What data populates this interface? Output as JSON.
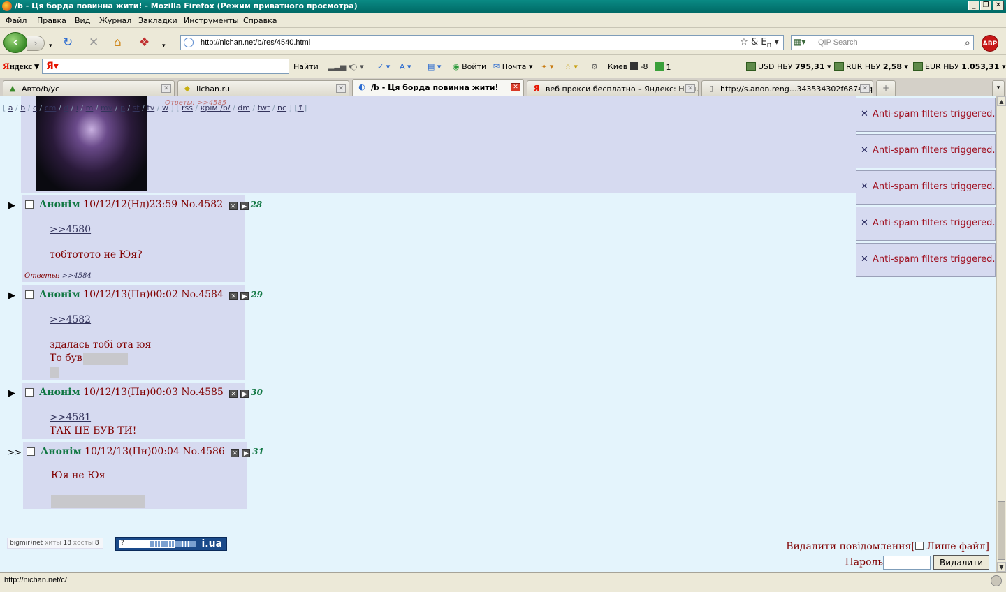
{
  "window": {
    "title": "/b - Ця борда повинна жити! - Mozilla Firefox (Режим приватного просмотра)"
  },
  "menu": [
    "Файл",
    "Правка",
    "Вид",
    "Журнал",
    "Закладки",
    "Инструменты",
    "Справка"
  ],
  "navbar": {
    "url": "http://nichan.net/b/res/4540.html",
    "search_placeholder": "QIP Search",
    "abp_label": "ABP"
  },
  "yandex_bar": {
    "logo_prefix": "Я",
    "logo_rest": "ндекс",
    "find": "Найти",
    "login": "Войти",
    "mail": "Почта",
    "city": "Киев",
    "temp": "-8",
    "count": "1",
    "usd_label": "USD НБУ",
    "usd_value": "795,31",
    "rur_label": "RUR НБУ",
    "rur_value": "2,58",
    "eur_label": "EUR НБУ",
    "eur_value": "1.053,31"
  },
  "tabs": [
    {
      "label": "Авто/b/ус",
      "active": false
    },
    {
      "label": "Ilchan.ru",
      "active": false
    },
    {
      "label": "/b - Ця борда повинна жити!",
      "active": true
    },
    {
      "label": "веб прокси бесплатно – Яндекс: Наш...",
      "active": false
    },
    {
      "label": "http://s.anon.reng...343534302f68746q6p",
      "active": false
    }
  ],
  "boardnav": {
    "links": [
      "a",
      "b",
      "c",
      "cm",
      "d",
      "i",
      "m",
      "mv",
      "p",
      "st",
      "tv",
      "w",
      "rss",
      "крім /b/",
      "dm",
      "twt",
      "nc",
      "↑"
    ],
    "overlay_replies": "Ответы: >>4585"
  },
  "posts": [
    {
      "name": "Анонім",
      "date": "10/12/12(Нд)23:59",
      "no": "No.4582",
      "num": "28",
      "marker": "▶",
      "reflink": ">>4580",
      "text": "тобтототo не Юя?",
      "replies_label": "Ответы:",
      "replies_link": ">>4584"
    },
    {
      "name": "Анонім",
      "date": "10/12/13(Пн)00:02",
      "no": "No.4584",
      "num": "29",
      "marker": "▶",
      "reflink": ">>4582",
      "text": "здалась тобі ота юя",
      "text2": "То був"
    },
    {
      "name": "Анонім",
      "date": "10/12/13(Пн)00:03",
      "no": "No.4585",
      "num": "30",
      "marker": "▶",
      "reflink": ">>4581",
      "text": "ТАК ЦЕ БУВ ТИ!"
    },
    {
      "name": "Анонім",
      "date": "10/12/13(Пн)00:04",
      "no": "No.4586",
      "num": "31",
      "marker": ">>",
      "text": "Юя не Юя"
    }
  ],
  "footer": {
    "counter1_brand": "bigmir)net",
    "counter1_hits_label": "хиты",
    "counter1_hits": "18",
    "counter1_hosts_label": "хосты",
    "counter1_hosts": "8",
    "counter2_brand": "i.ua",
    "counter2_q": "?",
    "delete_label": "Видалити повідомлення[",
    "only_file": "Лише файл]",
    "password_label": "Пароль",
    "delete_button": "Видалити"
  },
  "notifications": [
    "Anti-spam filters triggered.",
    "Anti-spam filters triggered.",
    "Anti-spam filters triggered.",
    "Anti-spam filters triggered.",
    "Anti-spam filters triggered."
  ],
  "statusbar": {
    "text": "http://nichan.net/c/"
  }
}
